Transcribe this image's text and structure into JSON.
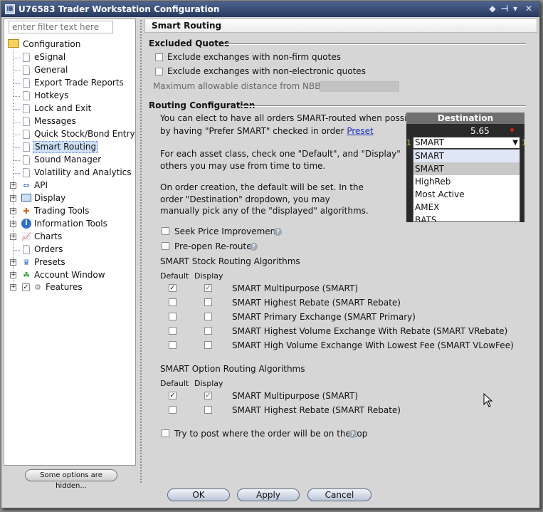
{
  "window": {
    "title": "U76583 Trader Workstation Configuration",
    "app_icon": "IB"
  },
  "sidebar": {
    "filter_placeholder": "enter filter text here",
    "root_label": "Configuration",
    "items": [
      {
        "label": "eSignal"
      },
      {
        "label": "General"
      },
      {
        "label": "Export Trade Reports"
      },
      {
        "label": "Hotkeys"
      },
      {
        "label": "Lock and Exit"
      },
      {
        "label": "Messages"
      },
      {
        "label": "Quick Stock/Bond Entry"
      },
      {
        "label": "Smart Routing"
      },
      {
        "label": "Sound Manager"
      },
      {
        "label": "Volatility and Analytics"
      },
      {
        "label": "API",
        "icon": "api-icon"
      },
      {
        "label": "Display",
        "icon": "display-icon"
      },
      {
        "label": "Trading Tools",
        "icon": "trading-tools-icon"
      },
      {
        "label": "Information Tools",
        "icon": "information-icon"
      },
      {
        "label": "Charts",
        "icon": "chart-icon"
      },
      {
        "label": "Orders",
        "icon": "orders-icon"
      },
      {
        "label": "Presets",
        "icon": "presets-icon"
      },
      {
        "label": "Account Window",
        "icon": "account-icon"
      },
      {
        "label": "Features",
        "icon": "features-icon"
      }
    ],
    "hidden_options_button": "Some options are hidden..."
  },
  "page": {
    "title": "Smart Routing"
  },
  "excluded_quotes": {
    "heading": "Excluded Quotes",
    "opt1": "Exclude exchanges with non-firm quotes",
    "opt2": "Exclude exchanges with non-electronic quotes",
    "nbbo_label": "Maximum allowable distance from NBBO",
    "nbbo_value": ""
  },
  "routing": {
    "heading": "Routing Configuration",
    "para1_line1": "You can elect to have all orders SMART-routed when possible",
    "para1_line2": "by having \"Prefer SMART\" checked in order",
    "preset_link": "Preset",
    "para2_line1": "For each asset class, check one \"Default\", and \"Display\"",
    "para2_line2": "others you may use from time to time.",
    "para3_line1": "On order creation, the default will be set. In the",
    "para3_line2": "order \"Destination\" dropdown, you may",
    "para3_line3": "manually pick any of the \"displayed\" algorithms.",
    "seek_price": "Seek Price Improvement",
    "preopen": "Pre-open Re-route",
    "stock_heading": "SMART Stock Routing Algorithms",
    "option_heading": "SMART Option Routing Algorithms",
    "col_default": "Default",
    "col_display": "Display",
    "stock_algos": [
      {
        "name": "SMART Multipurpose (SMART)",
        "default": true,
        "display": true
      },
      {
        "name": "SMART Highest Rebate (SMART Rebate)",
        "default": false,
        "display": false
      },
      {
        "name": "SMART Primary Exchange (SMART Primary)",
        "default": false,
        "display": false
      },
      {
        "name": "SMART Highest Volume Exchange With Rebate (SMART VRebate)",
        "default": false,
        "display": false
      },
      {
        "name": "SMART High Volume Exchange With Lowest Fee (SMART VLowFee)",
        "default": false,
        "display": false
      }
    ],
    "option_algos": [
      {
        "name": "SMART Multipurpose (SMART)",
        "default": true,
        "display": true
      },
      {
        "name": "SMART Highest Rebate (SMART Rebate)",
        "default": false,
        "display": false
      }
    ],
    "try_post": "Try to post where the order will be on the top"
  },
  "destination": {
    "header": "Destination",
    "price": "5.65",
    "left_marker": "1",
    "right_marker": "1",
    "selected": "SMART",
    "options": [
      "SMART",
      "SMART",
      "HighReb",
      "Most Active",
      "AMEX",
      "BATS"
    ]
  },
  "buttons": {
    "ok": "OK",
    "apply": "Apply",
    "cancel": "Cancel"
  }
}
